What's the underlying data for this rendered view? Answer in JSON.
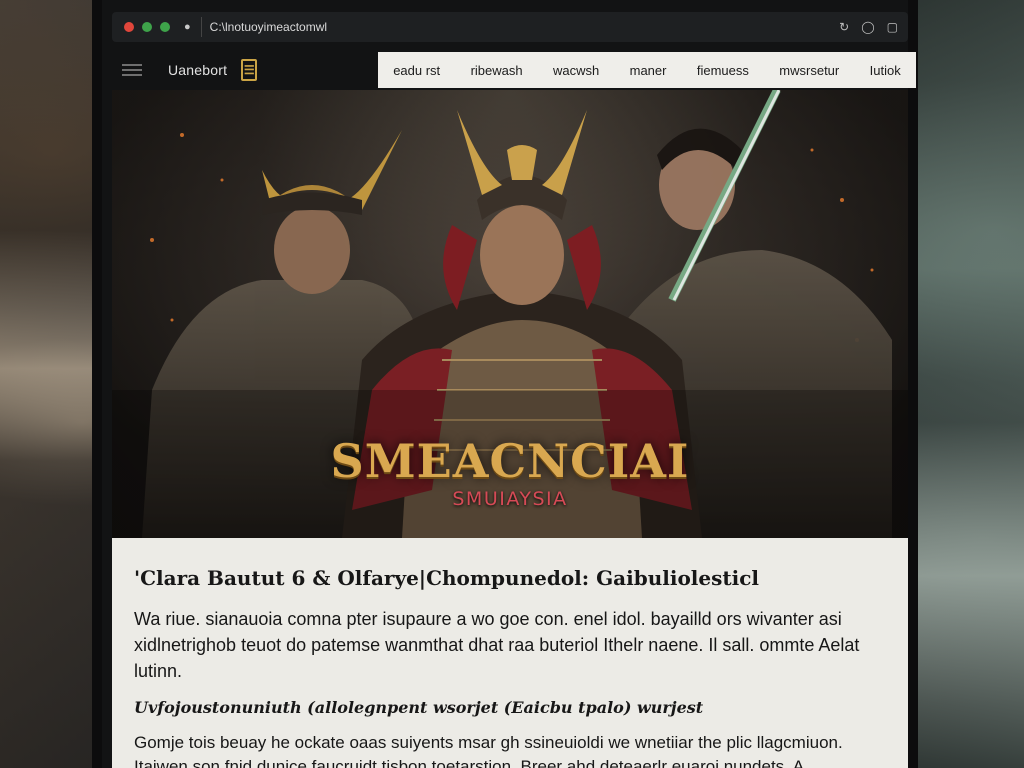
{
  "browser": {
    "url": "C:\\lnotuoyimeactomwl",
    "icons": [
      "reload-icon",
      "shield-icon",
      "extension-icon"
    ]
  },
  "site": {
    "brand": "Uanebort",
    "nav": [
      "eadu rst",
      "ribewash",
      "wacwsh",
      "maner",
      "fiemuess",
      "mwsrsetur",
      "Iutiok"
    ]
  },
  "hero": {
    "title": "SMEACNCIAI",
    "subtitle": "SMUIAYSIA"
  },
  "article": {
    "heading": "'Clara Bautut 6 & Olfarye|Chompunedol: Gaibuliolesticl",
    "paragraph1": "Wa riue. sianauoia comna pter isupaure a wo goe con. enel idol. bayailld ors wivanter asi xidlnetrighob teuot do patemse wanmthat dhat raa buteriol Ithelr naene. Il sall. ommte Aelat lutinn.",
    "subheading": "Uvfojoustonuniuth (allolegnpent wsorjet (Eaicbu tpalo) wurjest",
    "paragraph2": "Gomje tois beuay he ockate oaas suiyents msar gh ssineuioldi we wnetiiar the plic llagcmiuon. Itaiwen son fnid dunice faucruidt tisbon toetarstion. Breer ahd deteaerlr euaroi nundets. A"
  }
}
